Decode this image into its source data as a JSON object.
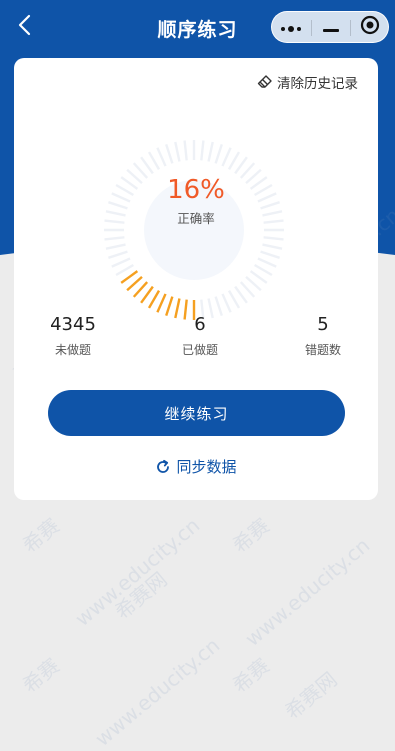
{
  "nav": {
    "title": "顺序练习",
    "back_icon": "chevron-left-icon",
    "capsule": {
      "more_icon": "more-dots-icon",
      "minimize_icon": "minimize-icon",
      "close_icon": "target-close-icon"
    }
  },
  "card": {
    "clear_history": {
      "label": "清除历史记录",
      "icon": "eraser-icon"
    },
    "accuracy": {
      "value": "16%",
      "label": "正确率",
      "fraction": 0.16
    },
    "stats": [
      {
        "value": "4345",
        "label": "未做题"
      },
      {
        "value": "6",
        "label": "已做题"
      },
      {
        "value": "5",
        "label": "错题数"
      }
    ],
    "continue_label": "继续练习",
    "sync": {
      "label": "同步数据",
      "icon": "refresh-icon"
    }
  },
  "watermark": {
    "brand": "希赛",
    "site": "www.educity.cn",
    "brand_full": "希赛网"
  },
  "colors": {
    "primary": "#0f54a8",
    "accent": "#f05a28",
    "gauge_active": "#f5a020",
    "gauge_track": "#eef1f6"
  }
}
